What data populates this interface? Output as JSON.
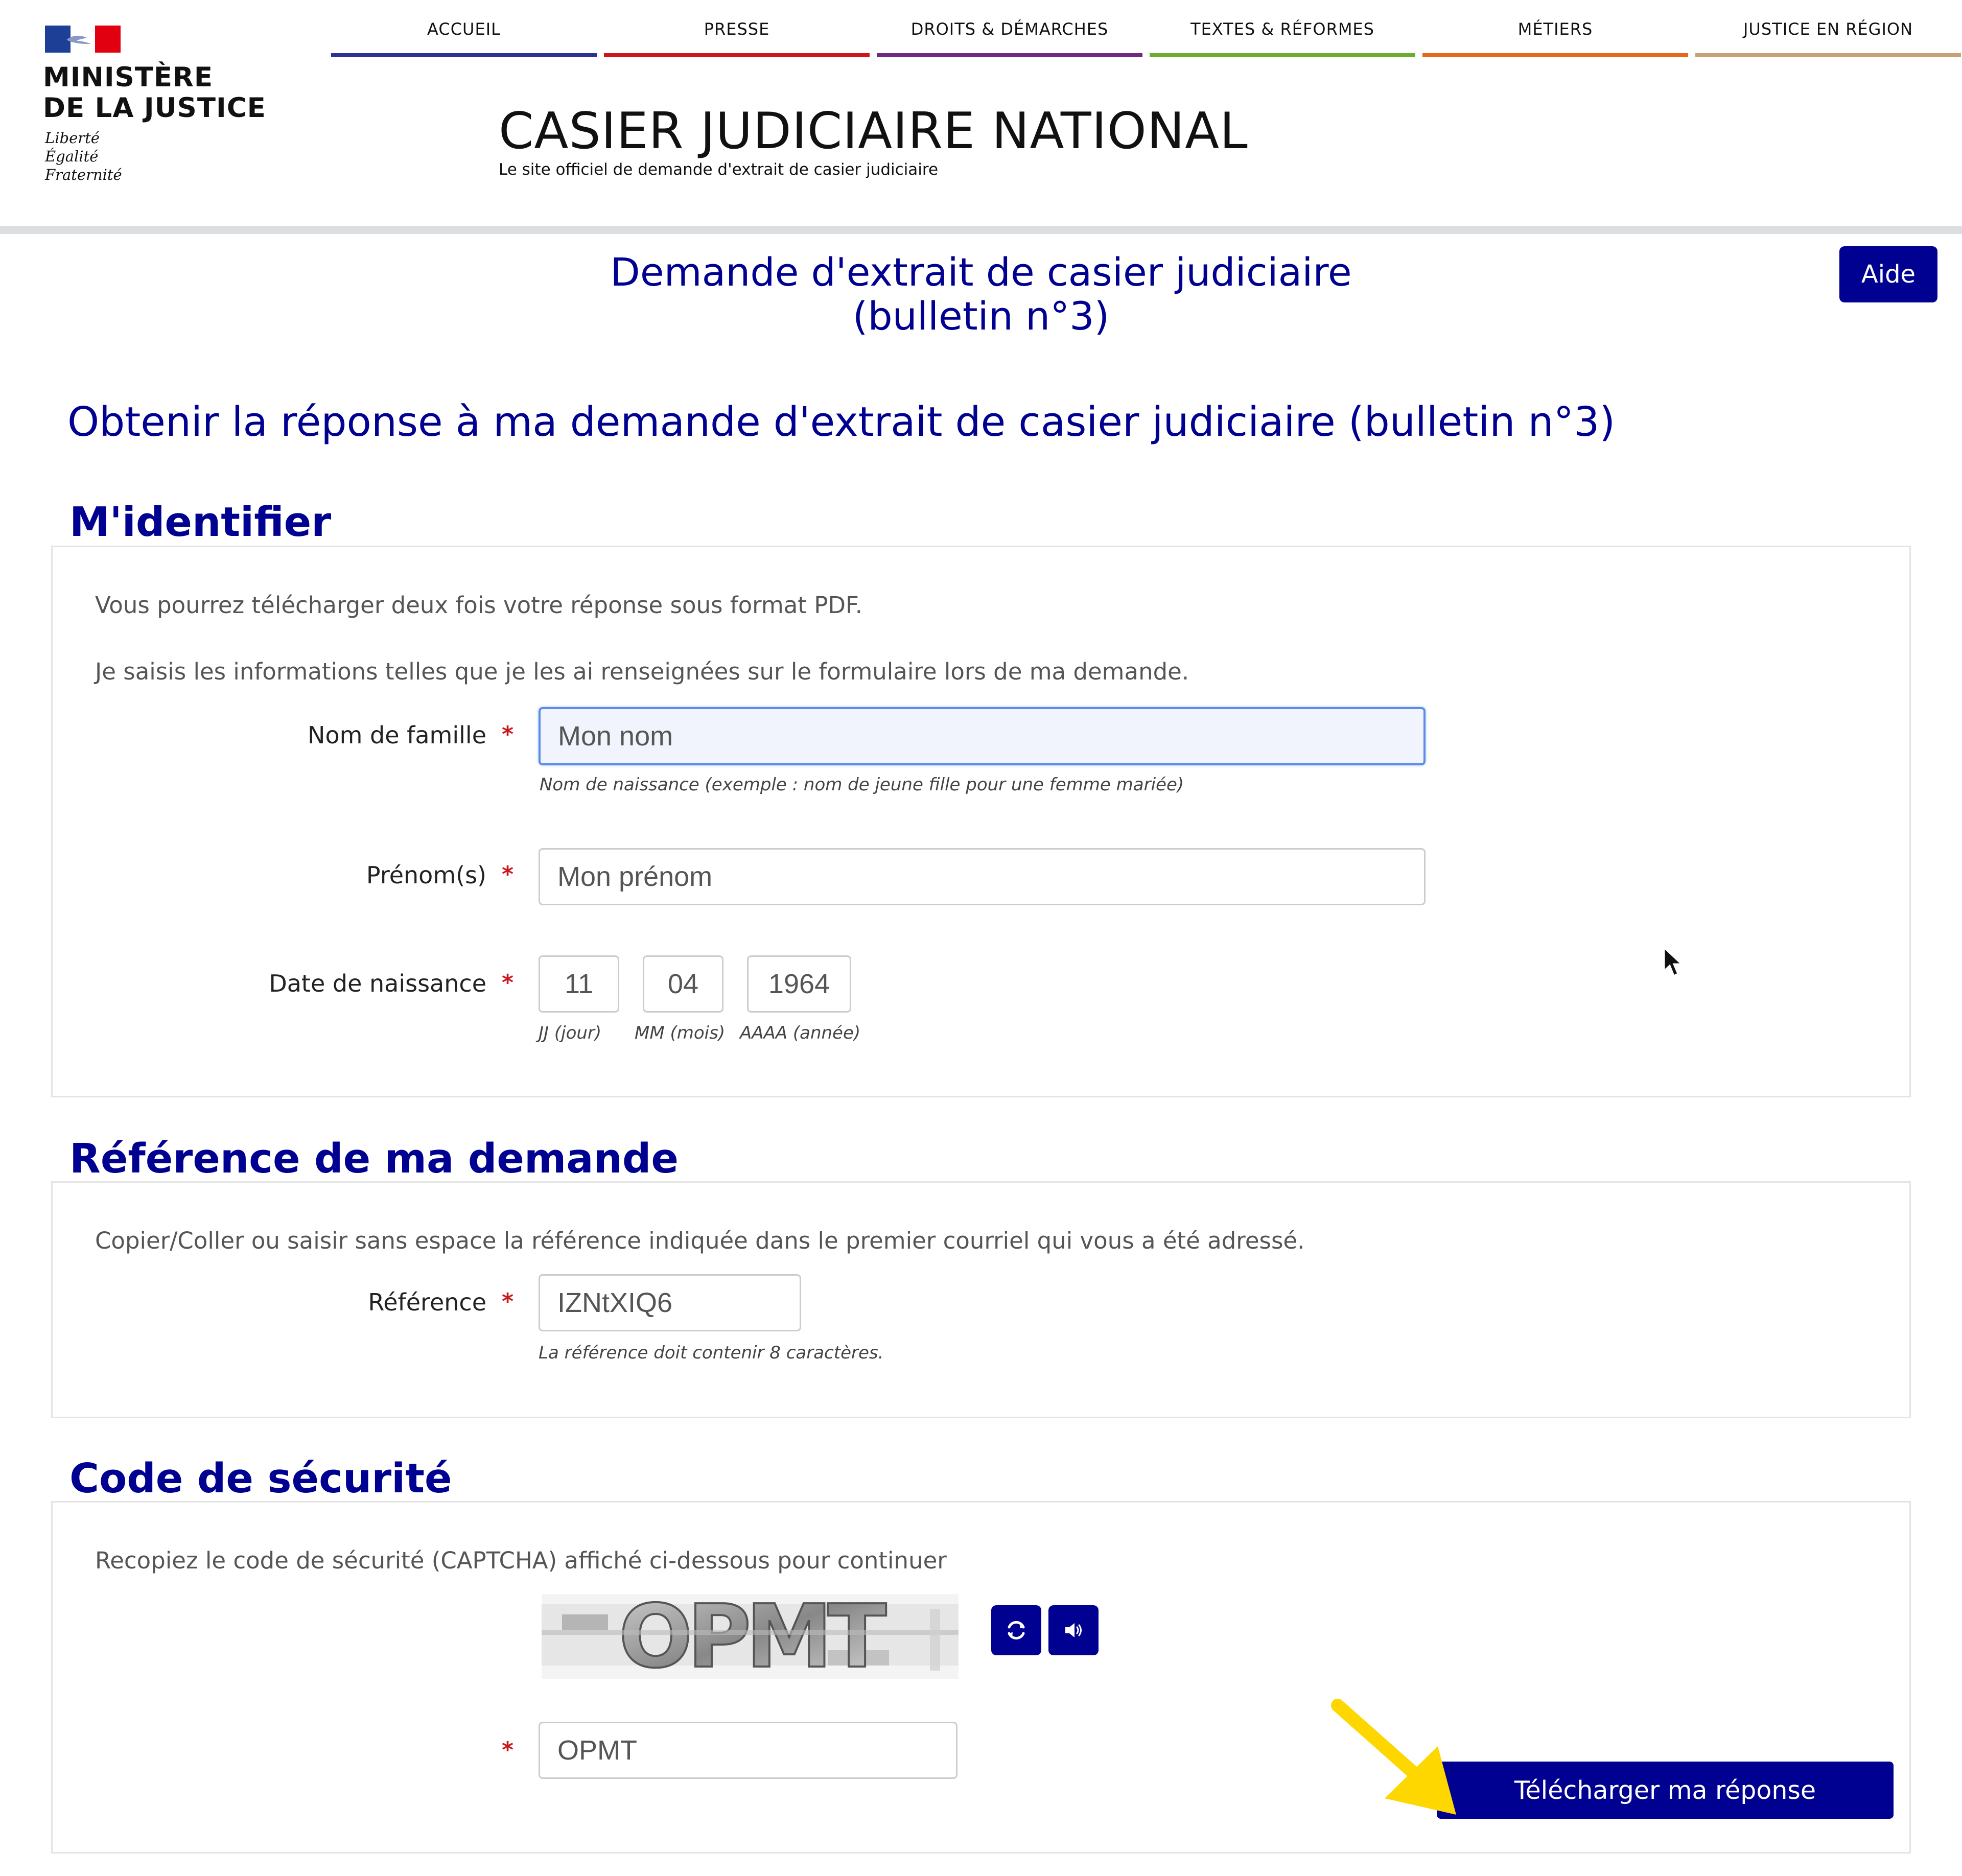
{
  "header": {
    "logo": {
      "ministry": "MINISTÈRE\nDE LA JUSTICE",
      "motto": "Liberté\nÉgalité\nFraternité"
    },
    "nav": [
      {
        "label": "ACCUEIL",
        "color": "#2a3591"
      },
      {
        "label": "PRESSE",
        "color": "#d0141c"
      },
      {
        "label": "DROITS & DÉMARCHES",
        "color": "#6e2a7f"
      },
      {
        "label": "TEXTES & RÉFORMES",
        "color": "#6cac2e"
      },
      {
        "label": "MÉTIERS",
        "color": "#e8651e"
      },
      {
        "label": "JUSTICE EN RÉGION",
        "color": "#c8a07a"
      }
    ],
    "site_title": "CASIER JUDICIAIRE NATIONAL",
    "site_subtitle": "Le site officiel de demande d'extrait de casier judiciaire"
  },
  "page": {
    "heading": "Demande d'extrait de casier judiciaire\n(bulletin n°3)",
    "help_label": "Aide",
    "main_title": "Obtenir la réponse à ma demande d'extrait de casier judiciaire (bulletin n°3)"
  },
  "identify": {
    "title": "M'identifier",
    "info1": "Vous pourrez télécharger deux fois votre réponse sous format PDF.",
    "info2": "Je saisis les informations telles que je les ai renseignées sur le formulaire lors de ma demande.",
    "lastname_label": "Nom de famille",
    "lastname_value": "Mon nom",
    "lastname_hint": "Nom de naissance (exemple : nom de jeune fille pour une femme mariée)",
    "firstname_label": "Prénom(s)",
    "firstname_value": "Mon prénom",
    "birthdate_label": "Date de naissance",
    "day": "11",
    "month": "04",
    "year": "1964",
    "day_hint": "JJ (jour)",
    "month_hint": "MM (mois)",
    "year_hint": "AAAA (année)",
    "required_mark": "*"
  },
  "reference": {
    "title": "Référence de ma demande",
    "info": "Copier/Coller ou saisir sans espace la référence indiquée dans le premier courriel qui vous a été adressé.",
    "label": "Référence",
    "value": "IZNtXIQ6",
    "hint": "La référence doit contenir 8 caractères."
  },
  "security": {
    "title": "Code de sécurité",
    "info": "Recopiez le code de sécurité (CAPTCHA) affiché ci-dessous pour continuer",
    "captcha_text": "OPMT",
    "value": "OPMT",
    "refresh_icon": "refresh-icon",
    "audio_icon": "speaker-icon"
  },
  "actions": {
    "download_label": "Télécharger ma réponse"
  },
  "colors": {
    "primary": "#000091",
    "required": "#c9191e",
    "annotation_arrow": "#ffd700"
  }
}
